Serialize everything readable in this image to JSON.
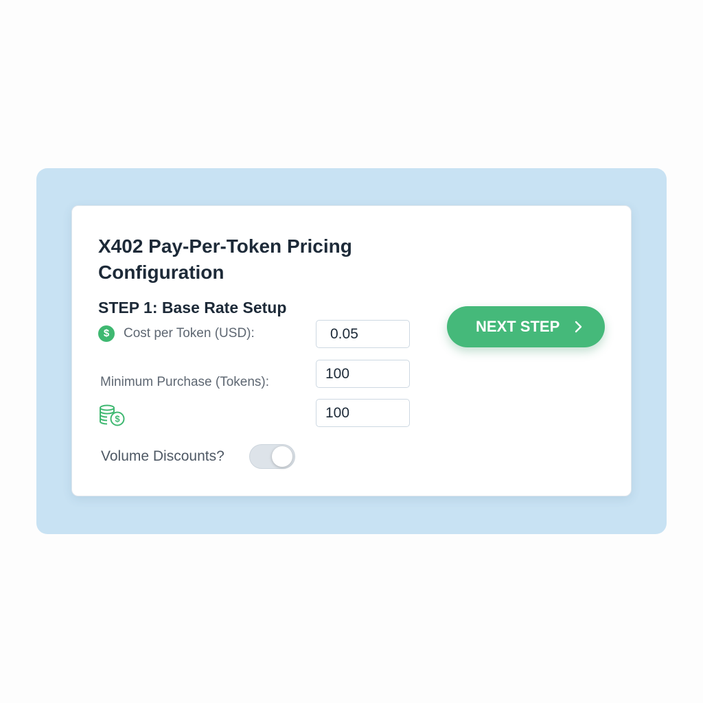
{
  "form": {
    "title": "X402 Pay-Per-Token Pricing Configuration",
    "step_title": "STEP 1: Base Rate Setup",
    "fields": {
      "cost_per_token": {
        "label": "Cost per Token (USD):",
        "value": "0.05",
        "icon": "dollar-icon"
      },
      "minimum_purchase": {
        "label": "Minimum Purchase (Tokens):",
        "value": "100"
      },
      "coins_field": {
        "value": "100",
        "icon": "coins-icon"
      },
      "volume_discounts": {
        "label": "Volume Discounts?",
        "enabled": true
      }
    },
    "next_button": {
      "label": "NEXT STEP",
      "icon": "chevron-right-icon"
    }
  },
  "colors": {
    "accent": "#45b97a",
    "outer_panel": "#c8e2f3",
    "card": "#ffffff",
    "text_dark": "#1d2a38",
    "text_muted": "#5e6772"
  }
}
